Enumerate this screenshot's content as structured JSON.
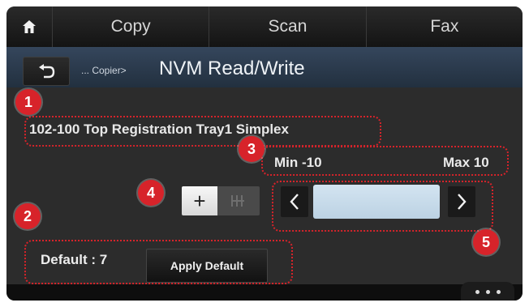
{
  "tabs": [
    "Copy",
    "Scan",
    "Fax"
  ],
  "header": {
    "breadcrumb": "... Copier>",
    "title": "NVM Read/Write"
  },
  "setting": {
    "name": "102-100 Top Registration Tray1 Simplex",
    "min_label": "Min -10",
    "max_label": "Max 10",
    "plus_label": "+",
    "value": ""
  },
  "defaults": {
    "label": "Default : 7",
    "apply_label": "Apply Default"
  },
  "callouts": [
    "1",
    "2",
    "3",
    "4",
    "5"
  ],
  "colors": {
    "callout": "#d7232a",
    "titlebar": "#2d3b4d",
    "value_field": "#c8dcec"
  },
  "icons": [
    "home-icon",
    "back-arrow-icon",
    "minus-bars-icon",
    "chevron-left-icon",
    "chevron-right-icon",
    "more-dots-icon"
  ]
}
